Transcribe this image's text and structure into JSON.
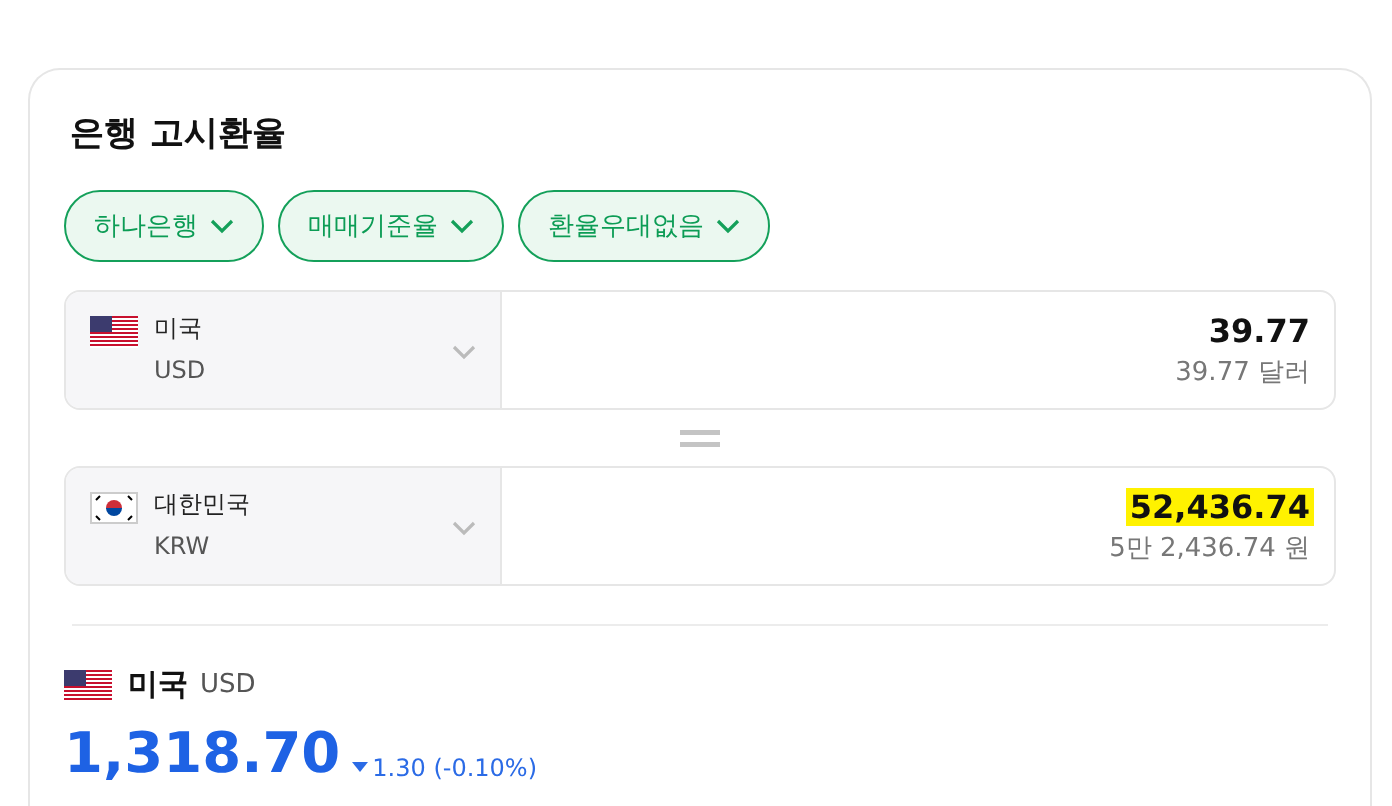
{
  "title": "은행 고시환율",
  "filters": [
    {
      "label": "하나은행"
    },
    {
      "label": "매매기준율"
    },
    {
      "label": "환율우대없음"
    }
  ],
  "converter": [
    {
      "kind": "us",
      "country": "미국",
      "code": "USD",
      "amount": "39.77",
      "amount_words": "39.77 달러",
      "highlighted": false
    },
    {
      "kind": "kr",
      "country": "대한민국",
      "code": "KRW",
      "amount": "52,436.74",
      "amount_words": "5만 2,436.74 원",
      "highlighted": true
    }
  ],
  "rate": {
    "kind": "us",
    "country": "미국",
    "code": "USD",
    "value": "1,318.70",
    "change": {
      "kind": "down",
      "text": "1.30 (-0.10%)"
    }
  }
}
